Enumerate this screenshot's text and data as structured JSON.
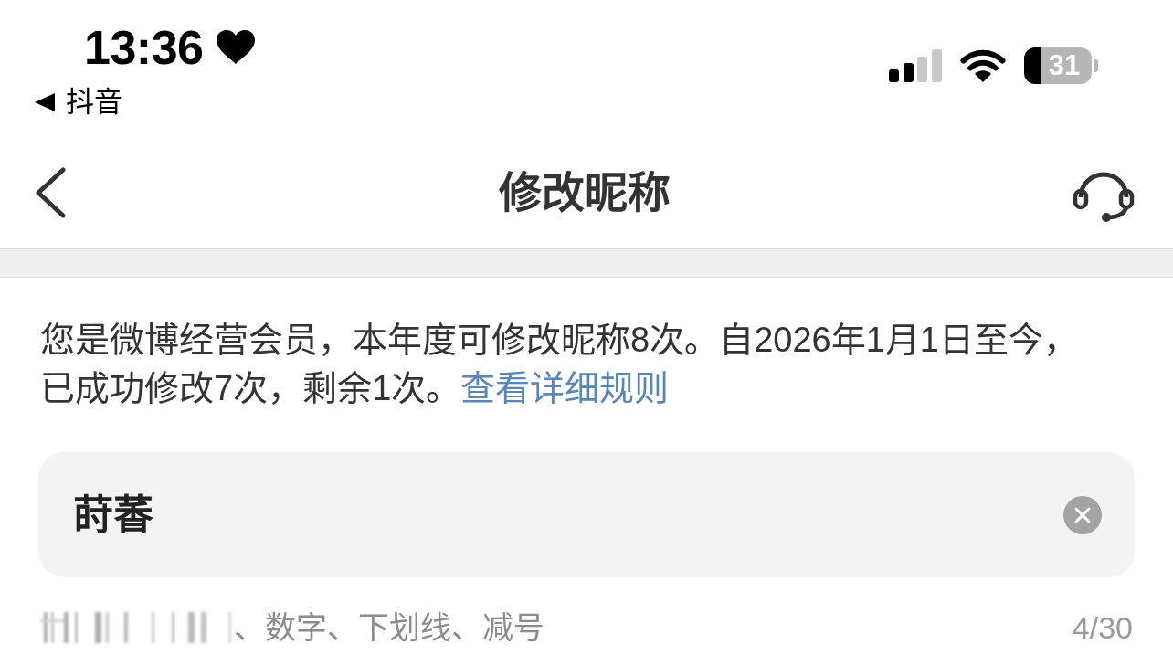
{
  "status_bar": {
    "time": "13:36",
    "back_app": {
      "label": "抖音"
    },
    "battery_text": "31"
  },
  "nav": {
    "title": "修改昵称"
  },
  "notice": {
    "text": "您是微博经营会员，本年度可修改昵称8次。自2026年1月1日至今，已成功修改7次，剩余1次。",
    "link": "查看详细规则"
  },
  "nickname_field": {
    "value": "莳萫"
  },
  "hint": {
    "text": "、数字、下划线、减号",
    "counter": "4/30"
  }
}
